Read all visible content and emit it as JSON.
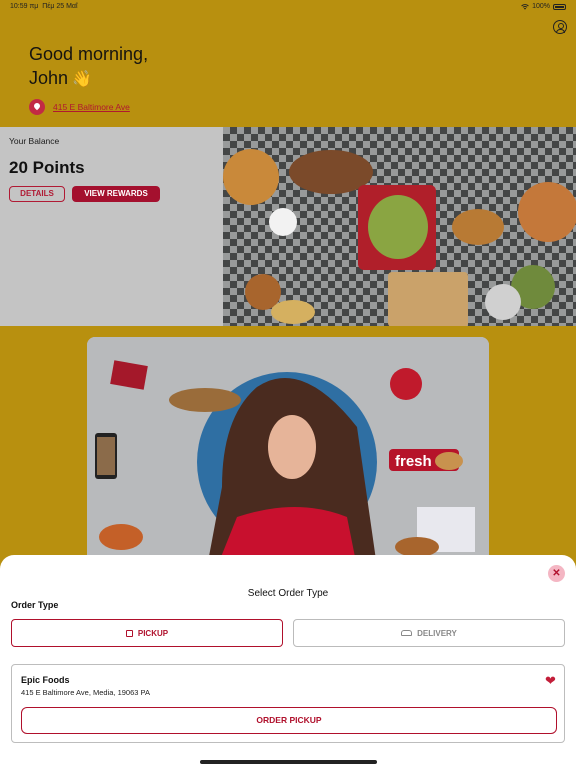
{
  "status": {
    "time": "10:59 πμ",
    "date": "Πέμ 25 Μαΐ",
    "battery": "100%"
  },
  "header": {
    "greeting_line1": "Good morning,",
    "greeting_line2": "John",
    "location": "415 E Baltimore Ave"
  },
  "balance": {
    "title": "Your Balance",
    "points": "20 Points",
    "details_label": "DETAILS",
    "rewards_label": "VIEW REWARDS"
  },
  "promo": {
    "badge_text": "fresh"
  },
  "sheet": {
    "title": "Select Order Type",
    "order_type_label": "Order Type",
    "pickup_label": "PICKUP",
    "delivery_label": "DELIVERY",
    "store": {
      "name": "Epic Foods",
      "address": "415 E Baltimore Ave, Media, 19063 PA",
      "favorited": true
    },
    "order_button_label": "ORDER PICKUP"
  },
  "colors": {
    "accent": "#b0102c",
    "background": "#b8900f",
    "sheet": "#ffffff"
  }
}
